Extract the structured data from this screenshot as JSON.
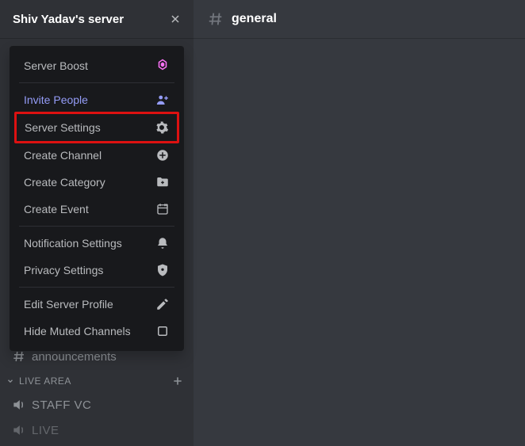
{
  "server": {
    "name": "Shiv Yadav's server"
  },
  "channel": {
    "name": "general"
  },
  "menu": {
    "boost": "Server Boost",
    "invite": "Invite People",
    "settings": "Server Settings",
    "createChannel": "Create Channel",
    "createCategory": "Create Category",
    "createEvent": "Create Event",
    "notification": "Notification Settings",
    "privacy": "Privacy Settings",
    "editProfile": "Edit Server Profile",
    "hideMuted": "Hide Muted Channels"
  },
  "sidebar": {
    "announcements": "announcements",
    "liveArea": "LIVE AREA",
    "staffVc": "STAFF VC",
    "live": "LIVE"
  },
  "colors": {
    "boost": "#ff73fa",
    "invite": "#949cf7",
    "highlight": "#d11"
  }
}
